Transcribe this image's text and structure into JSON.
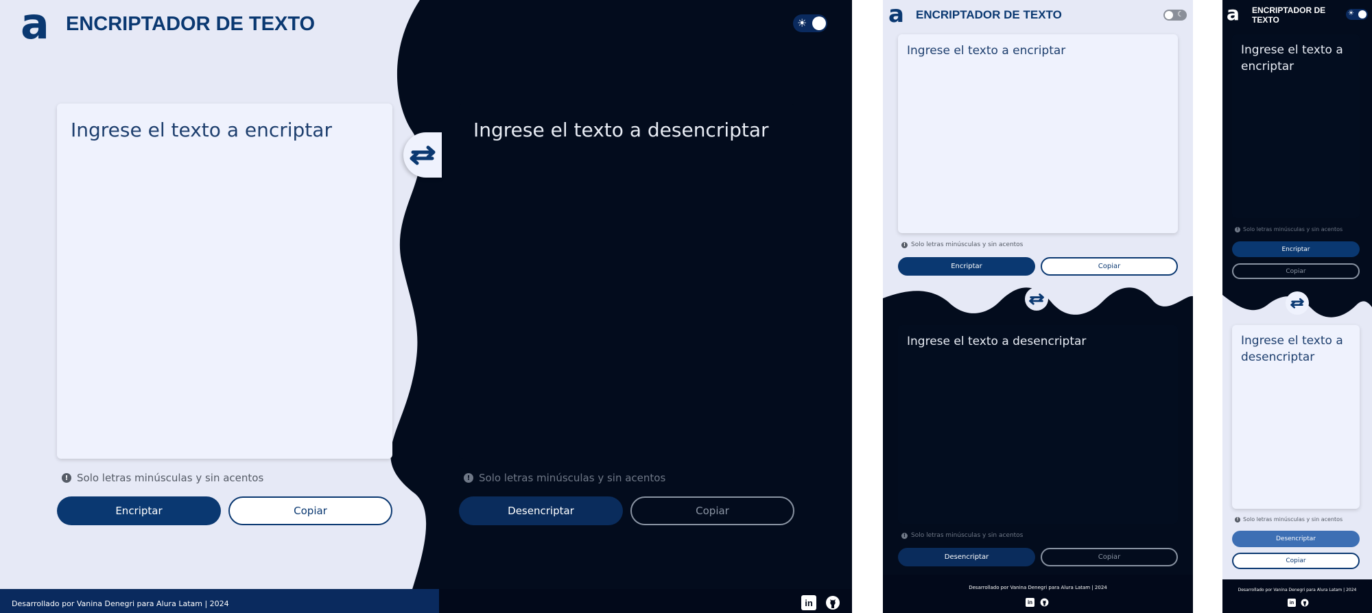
{
  "header": {
    "logo": "a",
    "title": "ENCRIPTADOR DE TEXTO"
  },
  "theme_toggle": {
    "light_icon": "sun-icon",
    "dark_icon": "moon-icon"
  },
  "encrypt_panel": {
    "placeholder": "Ingrese el texto a encriptar",
    "hint": "Solo letras minúsculas y sin acentos",
    "hint_icon": "info-icon",
    "primary_label": "Encriptar",
    "copy_label": "Copiar"
  },
  "decrypt_panel": {
    "placeholder": "Ingrese el texto a desencriptar",
    "hint": "Solo letras minúsculas y sin acentos",
    "hint_icon": "info-icon",
    "primary_label": "Desencriptar",
    "copy_label": "Copiar"
  },
  "swap_icon": "swap-arrows-icon",
  "footer": {
    "credit": "Desarrollado por Vanina Denegri para Alura Latam | 2024",
    "linkedin_icon": "linkedin-icon",
    "github_icon": "github-icon"
  },
  "colors": {
    "brand": "#0a3871",
    "light_bg": "#e6e9f6",
    "dark_bg": "#030c1d",
    "textarea_light": "#eff2fd"
  }
}
